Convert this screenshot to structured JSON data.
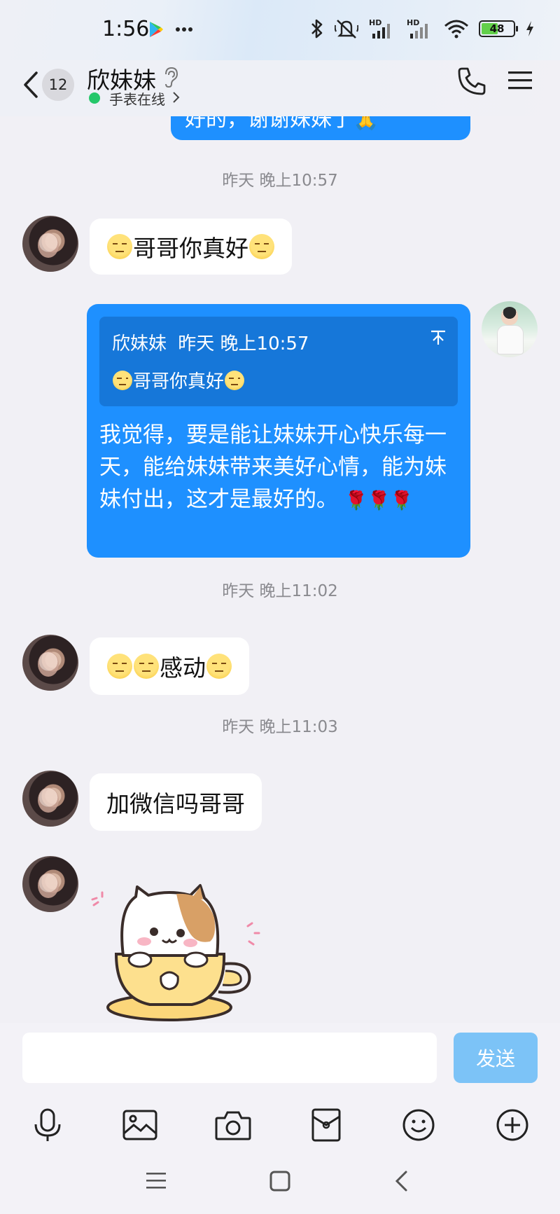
{
  "status_bar": {
    "time": "1:56",
    "battery_level": "48",
    "signal_label_1": "HD",
    "signal_label_2": "HD"
  },
  "header": {
    "unread_count": "12",
    "contact_name": "欣妹妹",
    "online_status": "手表在线"
  },
  "chat": {
    "previous_message_fragment": "好的，谢谢妹妹了🙏",
    "messages": [
      {
        "type": "timestamp",
        "text": "昨天 晚上10:57"
      },
      {
        "type": "received",
        "text": "哥哥你真好"
      },
      {
        "type": "sent",
        "quote_sender": "欣妹妹",
        "quote_time": "昨天 晚上10:57",
        "quote_text": "哥哥你真好",
        "quote_collapse": "⌃",
        "text": "我觉得，要是能让妹妹开心快乐每一天，能给妹妹带来美好心情，能为妹妹付出，这才是最好的。",
        "trailing_emoji": "🌹🌹🌹"
      },
      {
        "type": "timestamp",
        "text": "昨天 晚上11:02"
      },
      {
        "type": "received",
        "text": "感动"
      },
      {
        "type": "timestamp",
        "text": "昨天 晚上11:03"
      },
      {
        "type": "received",
        "text": "加微信吗哥哥"
      },
      {
        "type": "received_sticker",
        "sticker": "cat-in-teacup-sticker"
      }
    ]
  },
  "input": {
    "placeholder": "",
    "send_label": "发送"
  },
  "toolbar": {
    "icons": [
      "microphone-icon",
      "image-icon",
      "camera-icon",
      "red-packet-icon",
      "emoji-icon",
      "plus-icon"
    ]
  },
  "system_nav": {
    "icons": [
      "menu-nav-icon",
      "home-nav-icon",
      "back-nav-icon"
    ]
  },
  "colors": {
    "accent": "#1e90ff",
    "online": "#25c76a",
    "send_disabled": "#7cc3f7",
    "background": "#f1f0f5"
  }
}
